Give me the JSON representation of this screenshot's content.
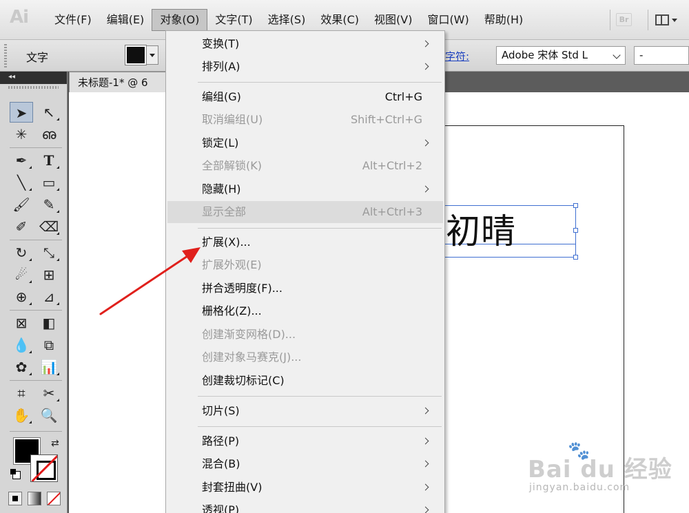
{
  "app": {
    "logo": "Ai"
  },
  "menubar": {
    "items": [
      {
        "label": "文件(F)"
      },
      {
        "label": "编辑(E)"
      },
      {
        "label": "对象(O)"
      },
      {
        "label": "文字(T)"
      },
      {
        "label": "选择(S)"
      },
      {
        "label": "效果(C)"
      },
      {
        "label": "视图(V)"
      },
      {
        "label": "窗口(W)"
      },
      {
        "label": "帮助(H)"
      }
    ],
    "active_index": 2,
    "bridge_label": "Br"
  },
  "controlbar": {
    "tool_name": "文字",
    "char_label": "字符:",
    "font_family": "Adobe 宋体 Std L",
    "font_style": "-"
  },
  "document": {
    "tab_title": "未标题-1* @ 6",
    "canvas_text": "雨初晴"
  },
  "object_menu": {
    "items": [
      {
        "label": "变换(T)",
        "shortcut": "",
        "submenu": true,
        "disabled": false
      },
      {
        "label": "排列(A)",
        "shortcut": "",
        "submenu": true,
        "disabled": false
      },
      {
        "label": "编组(G)",
        "shortcut": "Ctrl+G",
        "submenu": false,
        "disabled": false
      },
      {
        "label": "取消编组(U)",
        "shortcut": "Shift+Ctrl+G",
        "submenu": false,
        "disabled": true
      },
      {
        "label": "锁定(L)",
        "shortcut": "",
        "submenu": true,
        "disabled": false
      },
      {
        "label": "全部解锁(K)",
        "shortcut": "Alt+Ctrl+2",
        "submenu": false,
        "disabled": true
      },
      {
        "label": "隐藏(H)",
        "shortcut": "",
        "submenu": true,
        "disabled": false
      },
      {
        "label": "显示全部",
        "shortcut": "Alt+Ctrl+3",
        "submenu": false,
        "disabled": true
      },
      {
        "label": "扩展(X)...",
        "shortcut": "",
        "submenu": false,
        "disabled": false
      },
      {
        "label": "扩展外观(E)",
        "shortcut": "",
        "submenu": false,
        "disabled": true
      },
      {
        "label": "拼合透明度(F)...",
        "shortcut": "",
        "submenu": false,
        "disabled": false
      },
      {
        "label": "栅格化(Z)...",
        "shortcut": "",
        "submenu": false,
        "disabled": false
      },
      {
        "label": "创建渐变网格(D)...",
        "shortcut": "",
        "submenu": false,
        "disabled": true
      },
      {
        "label": "创建对象马赛克(J)...",
        "shortcut": "",
        "submenu": false,
        "disabled": true
      },
      {
        "label": "创建裁切标记(C)",
        "shortcut": "",
        "submenu": false,
        "disabled": false
      },
      {
        "label": "切片(S)",
        "shortcut": "",
        "submenu": true,
        "disabled": false
      },
      {
        "label": "路径(P)",
        "shortcut": "",
        "submenu": true,
        "disabled": false
      },
      {
        "label": "混合(B)",
        "shortcut": "",
        "submenu": true,
        "disabled": false
      },
      {
        "label": "封套扭曲(V)",
        "shortcut": "",
        "submenu": true,
        "disabled": false
      },
      {
        "label": "透视(P)",
        "shortcut": "",
        "submenu": true,
        "disabled": false
      }
    ],
    "highlighted_index": 7
  },
  "colors": {
    "annotation_arrow": "#e0201c",
    "selection_blue": "#3f6fd1"
  },
  "watermark": {
    "main": "Bai du 经验",
    "sub": "jingyan.baidu.com"
  }
}
